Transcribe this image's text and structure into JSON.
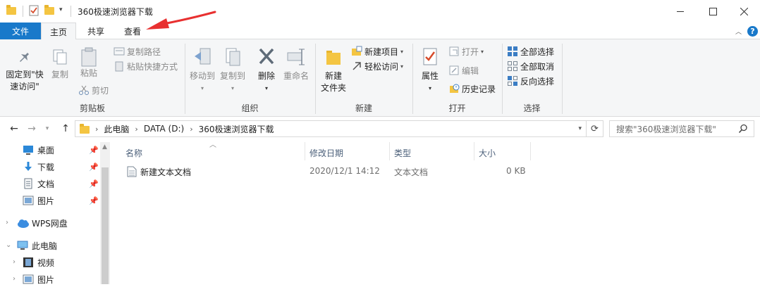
{
  "window": {
    "title": "360极速浏览器下载",
    "controls": [
      "minimize",
      "maximize",
      "close"
    ]
  },
  "tabs": {
    "file": "文件",
    "items": [
      "主页",
      "共享",
      "查看"
    ],
    "active": "主页"
  },
  "ribbon": {
    "clipboard": {
      "label": "剪贴板",
      "pin": "固定到\"快\n速访问\"",
      "copy": "复制",
      "paste": "粘贴",
      "copy_path": "复制路径",
      "paste_shortcut": "粘贴快捷方式",
      "cut": "剪切"
    },
    "organize": {
      "label": "组织",
      "move_to": "移动到",
      "copy_to": "复制到",
      "delete": "删除",
      "rename": "重命名"
    },
    "new": {
      "label": "新建",
      "new_folder_line1": "新建",
      "new_folder_line2": "文件夹",
      "new_item": "新建项目",
      "easy_access": "轻松访问"
    },
    "open": {
      "label": "打开",
      "properties": "属性",
      "open": "打开",
      "edit": "编辑",
      "history": "历史记录"
    },
    "select": {
      "label": "选择",
      "select_all": "全部选择",
      "select_none": "全部取消",
      "invert": "反向选择"
    }
  },
  "address": {
    "crumbs": [
      "此电脑",
      "DATA (D:)",
      "360极速浏览器下载"
    ],
    "search_placeholder": "搜索\"360极速浏览器下载\""
  },
  "nav": {
    "quick": [
      {
        "label": "桌面",
        "icon": "desktop-icon"
      },
      {
        "label": "下载",
        "icon": "download-icon"
      },
      {
        "label": "文档",
        "icon": "document-icon"
      },
      {
        "label": "图片",
        "icon": "pictures-icon"
      }
    ],
    "wps": "WPS网盘",
    "pc": "此电脑",
    "pc_children": [
      {
        "label": "视频",
        "icon": "video-icon"
      },
      {
        "label": "图片",
        "icon": "pictures-icon"
      }
    ]
  },
  "files": {
    "columns": [
      "名称",
      "修改日期",
      "类型",
      "大小"
    ],
    "rows": [
      {
        "name": "新建文本文档",
        "modified": "2020/12/1 14:12",
        "type": "文本文档",
        "size": "0 KB"
      }
    ]
  },
  "colors": {
    "accent": "#1979ca",
    "ribbon_bg": "#f5f6f7",
    "header_text": "#4c607a",
    "annotation_arrow": "#e83030"
  }
}
